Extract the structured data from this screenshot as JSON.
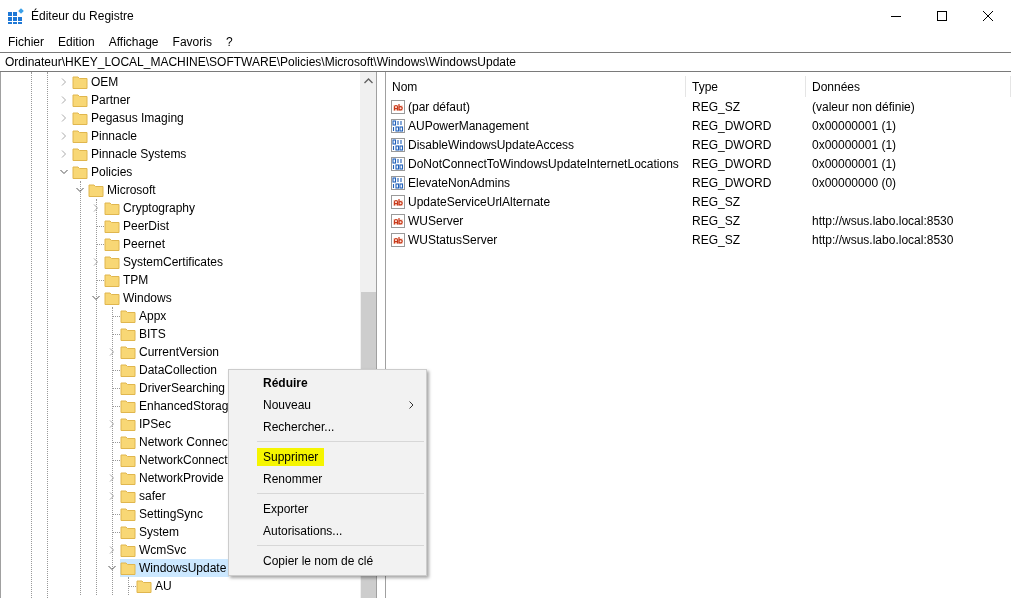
{
  "window": {
    "title": "Éditeur du Registre"
  },
  "menu_bar": [
    "Fichier",
    "Edition",
    "Affichage",
    "Favoris",
    "?"
  ],
  "address_bar": {
    "value": "Ordinateur\\HKEY_LOCAL_MACHINE\\SOFTWARE\\Policies\\Microsoft\\Windows\\WindowsUpdate"
  },
  "tree": {
    "items": [
      {
        "label": "OEM",
        "expandable": true,
        "expanded": false,
        "selected": false
      },
      {
        "label": "Partner",
        "expandable": true,
        "expanded": false,
        "selected": false
      },
      {
        "label": "Pegasus Imaging",
        "expandable": true,
        "expanded": false,
        "selected": false
      },
      {
        "label": "Pinnacle",
        "expandable": true,
        "expanded": false,
        "selected": false
      },
      {
        "label": "Pinnacle Systems",
        "expandable": true,
        "expanded": false,
        "selected": false
      },
      {
        "label": "Policies",
        "expandable": true,
        "expanded": true,
        "selected": false,
        "children": [
          {
            "label": "Microsoft",
            "expandable": true,
            "expanded": true,
            "selected": false,
            "children": [
              {
                "label": "Cryptography",
                "expandable": true,
                "expanded": false,
                "selected": false
              },
              {
                "label": "PeerDist",
                "expandable": false,
                "selected": false
              },
              {
                "label": "Peernet",
                "expandable": false,
                "selected": false
              },
              {
                "label": "SystemCertificates",
                "expandable": true,
                "expanded": false,
                "selected": false
              },
              {
                "label": "TPM",
                "expandable": false,
                "selected": false
              },
              {
                "label": "Windows",
                "expandable": true,
                "expanded": true,
                "selected": false,
                "children": [
                  {
                    "label": "Appx",
                    "expandable": false,
                    "selected": false
                  },
                  {
                    "label": "BITS",
                    "expandable": false,
                    "selected": false
                  },
                  {
                    "label": "CurrentVersion",
                    "expandable": true,
                    "expanded": false,
                    "selected": false
                  },
                  {
                    "label": "DataCollection",
                    "expandable": false,
                    "selected": false
                  },
                  {
                    "label": "DriverSearching",
                    "expandable": false,
                    "selected": false
                  },
                  {
                    "label": "EnhancedStorag",
                    "expandable": false,
                    "selected": false
                  },
                  {
                    "label": "IPSec",
                    "expandable": true,
                    "expanded": false,
                    "selected": false
                  },
                  {
                    "label": "Network Connec",
                    "expandable": false,
                    "selected": false
                  },
                  {
                    "label": "NetworkConnect",
                    "expandable": false,
                    "selected": false
                  },
                  {
                    "label": "NetworkProvide",
                    "expandable": true,
                    "expanded": false,
                    "selected": false
                  },
                  {
                    "label": "safer",
                    "expandable": true,
                    "expanded": false,
                    "selected": false
                  },
                  {
                    "label": "SettingSync",
                    "expandable": false,
                    "selected": false
                  },
                  {
                    "label": "System",
                    "expandable": false,
                    "selected": false
                  },
                  {
                    "label": "WcmSvc",
                    "expandable": true,
                    "expanded": false,
                    "selected": false
                  },
                  {
                    "label": "WindowsUpdate",
                    "expandable": true,
                    "expanded": true,
                    "selected": true,
                    "children": [
                      {
                        "label": "AU",
                        "expandable": false,
                        "selected": false
                      }
                    ]
                  }
                ]
              }
            ]
          }
        ]
      }
    ]
  },
  "values_table": {
    "columns": [
      "Nom",
      "Type",
      "Données"
    ],
    "rows": [
      {
        "kind": "string",
        "name": "(par défaut)",
        "type": "REG_SZ",
        "data": "(valeur non définie)"
      },
      {
        "kind": "binary",
        "name": "AUPowerManagement",
        "type": "REG_DWORD",
        "data": "0x00000001 (1)"
      },
      {
        "kind": "binary",
        "name": "DisableWindowsUpdateAccess",
        "type": "REG_DWORD",
        "data": "0x00000001 (1)"
      },
      {
        "kind": "binary",
        "name": "DoNotConnectToWindowsUpdateInternetLocations",
        "type": "REG_DWORD",
        "data": "0x00000001 (1)"
      },
      {
        "kind": "binary",
        "name": "ElevateNonAdmins",
        "type": "REG_DWORD",
        "data": "0x00000000 (0)"
      },
      {
        "kind": "string",
        "name": "UpdateServiceUrlAlternate",
        "type": "REG_SZ"
      },
      {
        "kind": "string",
        "name": "WUServer",
        "type": "REG_SZ",
        "data": "http://wsus.labo.local:8530"
      },
      {
        "kind": "string",
        "name": "WUStatusServer",
        "type": "REG_SZ",
        "data": "http://wsus.labo.local:8530"
      }
    ]
  },
  "context_menu": {
    "items": [
      {
        "kind": "item",
        "label": "Réduire",
        "bold": true,
        "submenu": false,
        "highlighted": false
      },
      {
        "kind": "item",
        "label": "Nouveau",
        "bold": false,
        "submenu": true,
        "highlighted": false
      },
      {
        "kind": "item",
        "label": "Rechercher...",
        "bold": false,
        "submenu": false,
        "highlighted": false
      },
      {
        "kind": "separator"
      },
      {
        "kind": "item",
        "label": "Supprimer",
        "bold": false,
        "submenu": false,
        "highlighted": true
      },
      {
        "kind": "item",
        "label": "Renommer",
        "bold": false,
        "submenu": false,
        "highlighted": false
      },
      {
        "kind": "separator"
      },
      {
        "kind": "item",
        "label": "Exporter",
        "bold": false,
        "submenu": false,
        "highlighted": false
      },
      {
        "kind": "item",
        "label": "Autorisations...",
        "bold": false,
        "submenu": false,
        "highlighted": false
      },
      {
        "kind": "separator"
      },
      {
        "kind": "item",
        "label": "Copier le nom de clé",
        "bold": false,
        "submenu": false,
        "highlighted": false
      }
    ]
  }
}
